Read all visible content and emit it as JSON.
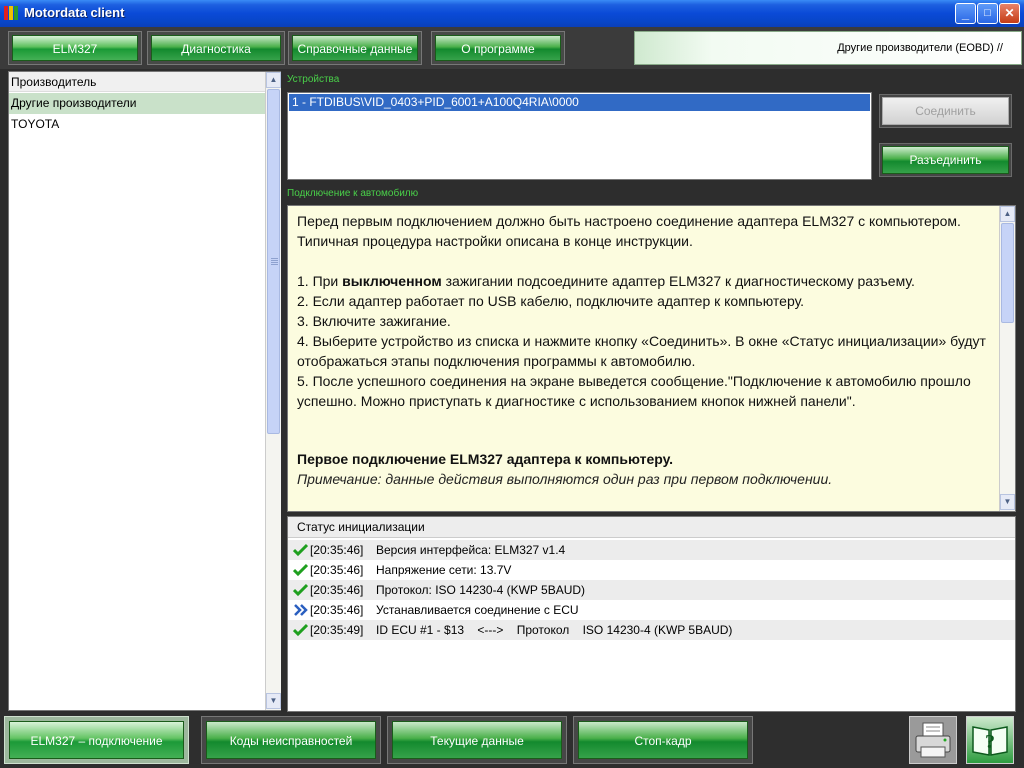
{
  "window": {
    "title": "Motordata client"
  },
  "title_buttons": {
    "minimize": "_",
    "maximize": "□",
    "close": "✕"
  },
  "top_menu": {
    "tabs": [
      {
        "label": "ELM327",
        "active": true
      },
      {
        "label": "Диагностика",
        "active": false
      },
      {
        "label": "Справочные данные",
        "active": false
      },
      {
        "label": "О программе",
        "active": false
      }
    ],
    "manufacturer_info": "Другие производители   (EOBD) //"
  },
  "left_panel": {
    "header": "Производитель",
    "items": [
      {
        "label": "Другие производители",
        "selected": true
      },
      {
        "label": "TOYOTA",
        "selected": false
      }
    ]
  },
  "devices": {
    "label": "Устройства",
    "items": [
      "1 - FTDIBUS\\VID_0403+PID_6001+A100Q4RIA\\0000"
    ],
    "connect_label": "Соединить",
    "disconnect_label": "Разъединить"
  },
  "instructions": {
    "label": "Подключение к автомобилю",
    "intro": "Перед первым подключением должно быть настроено соединение адаптера ELM327 с компьютером. Типичная процедура настройки описана в конце инструкции.",
    "step1_pre": "1. При ",
    "step1_bold": "выключенном",
    "step1_post": " зажигании подсоедините адаптер ELM327 к диагностическому разъему.",
    "step2": "2. Если адаптер работает по USB кабелю, подключите адаптер к компьютеру.",
    "step3": "3. Включите зажигание.",
    "step4": "4. Выберите устройство из списка и нажмите кнопку «Соединить». В окне «Статус инициализации» будут отображаться этапы подключения программы к автомобилю.",
    "step5": "5. После успешного соединения на экране выведется сообщение.\"Подключение к автомобилю прошло успешно. Можно приступать к диагностике с использованием кнопок нижней панели\".",
    "heading": "Первое подключение ELM327 адаптера к компьютеру.",
    "note": "Примечание: данные действия выполняются один раз при первом подключении."
  },
  "status": {
    "header": "Статус инициализации",
    "rows": [
      {
        "icon": "check-icon",
        "time": "[20:35:46]",
        "message": "Версия интерфейса: ELM327 v1.4"
      },
      {
        "icon": "check-icon",
        "time": "[20:35:46]",
        "message": "Напряжение сети: 13.7V"
      },
      {
        "icon": "check-icon",
        "time": "[20:35:46]",
        "message": "Протокол: ISO 14230-4 (KWP 5BAUD)"
      },
      {
        "icon": "double-chevron-icon",
        "time": "[20:35:46]",
        "message": "Устанавливается соединение с ECU"
      },
      {
        "icon": "check-icon",
        "time": "[20:35:49]",
        "message": "ID ECU #1 - $13    <--->    Протокол    ISO 14230-4 (KWP 5BAUD)"
      }
    ]
  },
  "bottom_bar": {
    "buttons": [
      {
        "label": "ELM327 – подключение",
        "active": true
      },
      {
        "label": "Коды неисправностей",
        "active": false
      },
      {
        "label": "Текущие данные",
        "active": false
      },
      {
        "label": "Стоп-кадр",
        "active": false
      }
    ],
    "print_icon": "printer-icon",
    "help_icon": "help-book-icon"
  },
  "colors": {
    "titlebar": "#0a4ad7",
    "button_green": "#138a2e",
    "label_green": "#49d049",
    "selection_blue": "#316ac5",
    "instructions_bg": "#fcfcdf"
  }
}
